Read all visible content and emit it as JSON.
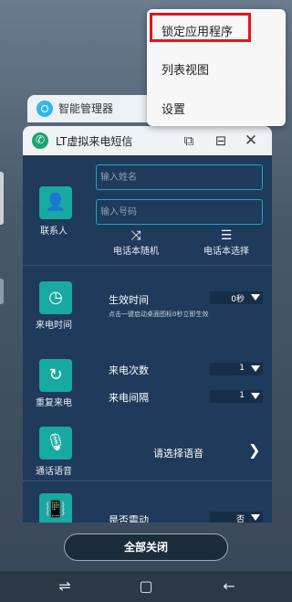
{
  "background_card": {
    "title": "智能管理器"
  },
  "window": {
    "title": "LT虚拟来电短信"
  },
  "menu": {
    "items": [
      "锁定应用程序",
      "列表视图",
      "设置"
    ]
  },
  "contacts": {
    "label": "联系人",
    "name_placeholder": "输入姓名",
    "number_placeholder": "输入号码",
    "random_label": "电话本随机",
    "choose_label": "电话本选择"
  },
  "call_time": {
    "label": "来电时间",
    "row_label": "生效时间",
    "value": "0秒",
    "hint": "点击一键启动桌面图标0秒立即生效"
  },
  "repeat": {
    "label": "重复来电",
    "count_label": "来电次数",
    "count_value": "1",
    "interval_label": "来电间隔",
    "interval_value": "1"
  },
  "voice": {
    "label": "通话语音",
    "select_text": "请选择语音"
  },
  "vibrate": {
    "row_label": "是否震动",
    "value": "否"
  },
  "close_all": "全部关闭",
  "colors": {
    "accent": "#18a9a1",
    "panel": "#1f3a5a",
    "highlight": "#e4141b"
  }
}
